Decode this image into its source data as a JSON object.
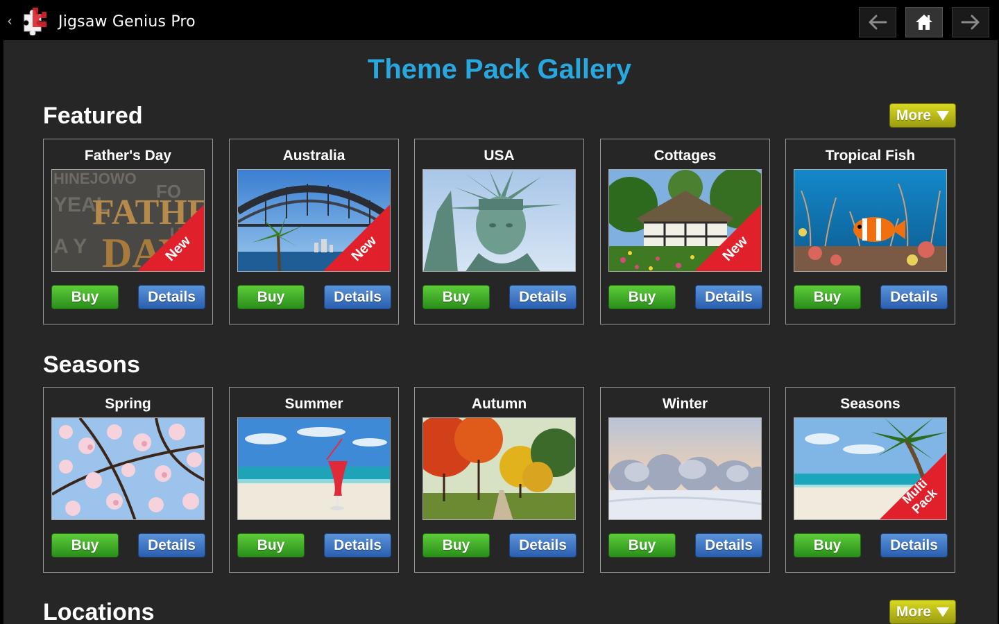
{
  "app": {
    "title": "Jigsaw Genius Pro"
  },
  "nav": {
    "back_icon": "arrow-left-icon",
    "home_icon": "home-icon",
    "forward_icon": "arrow-right-icon"
  },
  "gallery_title": "Theme Pack Gallery",
  "colors": {
    "accent": "#29a8e0",
    "buy": "#3fae29",
    "details": "#3a73c4",
    "more": "#c4c41a",
    "ribbon": "#e0202a"
  },
  "sections": [
    {
      "title": "Featured",
      "more_label": "More",
      "cards": [
        {
          "title": "Father's Day",
          "badge": "New",
          "buy": "Buy",
          "details": "Details"
        },
        {
          "title": "Australia",
          "badge": "New",
          "buy": "Buy",
          "details": "Details"
        },
        {
          "title": "USA",
          "badge": "",
          "buy": "Buy",
          "details": "Details"
        },
        {
          "title": "Cottages",
          "badge": "New",
          "buy": "Buy",
          "details": "Details"
        },
        {
          "title": "Tropical Fish",
          "badge": "",
          "buy": "Buy",
          "details": "Details"
        }
      ]
    },
    {
      "title": "Seasons",
      "more_label": "",
      "cards": [
        {
          "title": "Spring",
          "badge": "",
          "buy": "Buy",
          "details": "Details"
        },
        {
          "title": "Summer",
          "badge": "",
          "buy": "Buy",
          "details": "Details"
        },
        {
          "title": "Autumn",
          "badge": "",
          "buy": "Buy",
          "details": "Details"
        },
        {
          "title": "Winter",
          "badge": "",
          "buy": "Buy",
          "details": "Details"
        },
        {
          "title": "Seasons",
          "badge": "Multi Pack",
          "badge_line1": "Multi",
          "badge_line2": "Pack",
          "buy": "Buy",
          "details": "Details"
        }
      ]
    },
    {
      "title": "Locations",
      "more_label": "More",
      "cards": []
    }
  ],
  "father_day_art": {
    "line1": "FATHER'S",
    "line2": "DAY"
  }
}
